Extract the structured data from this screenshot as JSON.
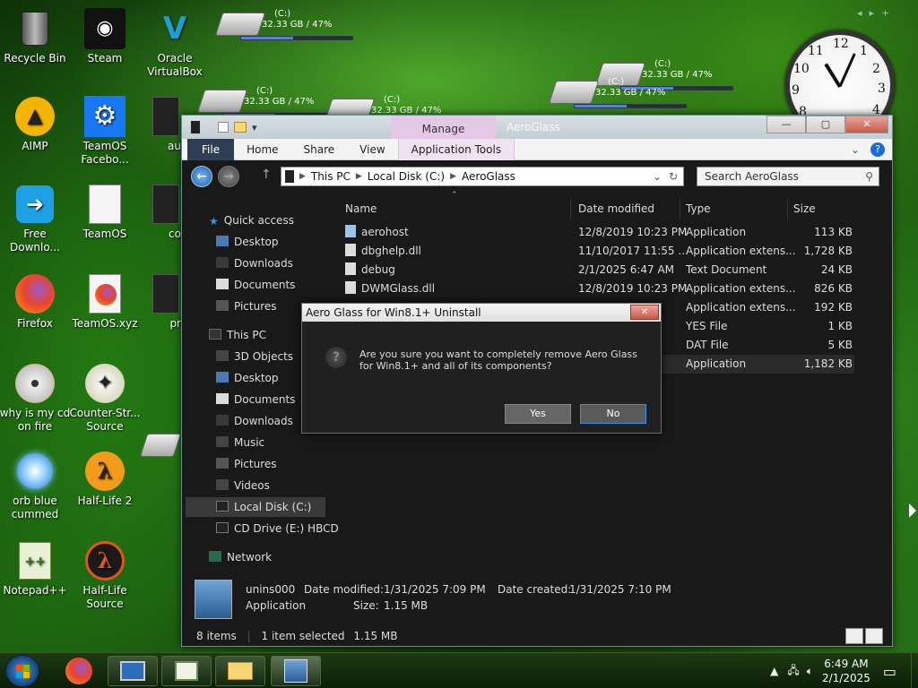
{
  "desktop": {
    "icons": [
      {
        "label": "Recycle Bin",
        "icon": "recycle-bin-icon"
      },
      {
        "label": "Steam",
        "icon": "steam-icon"
      },
      {
        "label": "Oracle VirtualBox",
        "icon": "virtualbox-icon"
      },
      {
        "label": "AIMP",
        "icon": "aimp-icon"
      },
      {
        "label": "TeamOS Facebo...",
        "icon": "settings-gear-icon"
      },
      {
        "label": "au",
        "icon": "shortcut-icon"
      },
      {
        "label": "Free Downlo...",
        "icon": "download-arrow-icon"
      },
      {
        "label": "TeamOS",
        "icon": "document-icon"
      },
      {
        "label": "co",
        "icon": "shortcut-icon"
      },
      {
        "label": "Firefox",
        "icon": "firefox-icon"
      },
      {
        "label": "TeamOS.xyz",
        "icon": "firefox-doc-icon"
      },
      {
        "label": "pr",
        "icon": "shortcut-icon"
      },
      {
        "label": "why is my cd on fire",
        "icon": "cd-fire-icon"
      },
      {
        "label": "Counter-Str... Source",
        "icon": "counter-strike-icon"
      },
      {
        "label": "orb blue cummed",
        "icon": "orb-icon"
      },
      {
        "label": "Half-Life 2",
        "icon": "half-life-2-icon"
      },
      {
        "label": "Notepad++",
        "icon": "notepad-plus-plus-icon"
      },
      {
        "label": "Half-Life Source",
        "icon": "half-life-source-icon"
      }
    ],
    "drive_widget": {
      "label": "(C:)",
      "usage": "32.33 GB / 47%",
      "used_fraction": 0.47
    }
  },
  "explorer": {
    "title": "AeroGlass",
    "context_tab": "Manage",
    "ribbon_tabs": [
      "File",
      "Home",
      "Share",
      "View",
      "Application Tools"
    ],
    "window_buttons": {
      "minimize": "—",
      "maximize": "▢",
      "close": "✕"
    },
    "address": [
      "This PC",
      "Local Disk (C:)",
      "AeroGlass"
    ],
    "search_placeholder": "Search AeroGlass",
    "nav": [
      {
        "label": "Quick access",
        "icon": "star-icon",
        "level": 0
      },
      {
        "label": "Desktop",
        "icon": "desktop-icon",
        "level": 1
      },
      {
        "label": "Downloads",
        "icon": "downloads-icon",
        "level": 1
      },
      {
        "label": "Documents",
        "icon": "documents-icon",
        "level": 1
      },
      {
        "label": "Pictures",
        "icon": "pictures-icon",
        "level": 1
      },
      {
        "label": "This PC",
        "icon": "computer-icon",
        "level": 0
      },
      {
        "label": "3D Objects",
        "icon": "objects-3d-icon",
        "level": 1
      },
      {
        "label": "Desktop",
        "icon": "desktop-icon",
        "level": 1
      },
      {
        "label": "Documents",
        "icon": "documents-icon",
        "level": 1
      },
      {
        "label": "Downloads",
        "icon": "downloads-icon",
        "level": 1
      },
      {
        "label": "Music",
        "icon": "music-icon",
        "level": 1
      },
      {
        "label": "Pictures",
        "icon": "pictures-icon",
        "level": 1
      },
      {
        "label": "Videos",
        "icon": "videos-icon",
        "level": 1
      },
      {
        "label": "Local Disk (C:)",
        "icon": "drive-icon",
        "level": 1,
        "selected": true
      },
      {
        "label": "CD Drive (E:) HBCD",
        "icon": "cd-drive-icon",
        "level": 1
      },
      {
        "label": "Network",
        "icon": "network-icon",
        "level": 0
      }
    ],
    "columns": [
      "Name",
      "Date modified",
      "Type",
      "Size"
    ],
    "files": [
      {
        "name": "aerohost",
        "date": "12/8/2019 10:23 PM",
        "type": "Application",
        "size": "113 KB"
      },
      {
        "name": "dbghelp.dll",
        "date": "11/10/2017 11:55 ...",
        "type": "Application extens...",
        "size": "1,728 KB"
      },
      {
        "name": "debug",
        "date": "2/1/2025 6:47 AM",
        "type": "Text Document",
        "size": "24 KB"
      },
      {
        "name": "DWMGlass.dll",
        "date": "12/8/2019 10:23 PM",
        "type": "Application extens...",
        "size": "826 KB"
      },
      {
        "name": "",
        "date": "",
        "type": "Application extens...",
        "size": "192 KB"
      },
      {
        "name": "",
        "date": "",
        "type": "YES File",
        "size": "1 KB"
      },
      {
        "name": "",
        "date": "",
        "type": "DAT File",
        "size": "5 KB"
      },
      {
        "name": "",
        "date": "",
        "type": "Application",
        "size": "1,182 KB",
        "selected": true
      }
    ],
    "details": {
      "name": "unins000",
      "kind": "Application",
      "date_modified_label": "Date modified:",
      "date_modified": "1/31/2025 7:09 PM",
      "date_created_label": "Date created:",
      "date_created": "1/31/2025 7:10 PM",
      "size_label": "Size:",
      "size": "1.15 MB"
    },
    "status": {
      "items": "8 items",
      "selected": "1 item selected",
      "size": "1.15 MB"
    }
  },
  "dialog": {
    "title": "Aero Glass for Win8.1+ Uninstall",
    "message": "Are you sure you want to completely remove Aero Glass for Win8.1+ and all of its components?",
    "yes": "Yes",
    "no": "No",
    "close": "✕"
  },
  "taskbar": {
    "items": [
      "firefox-icon",
      "remote-desktop-icon",
      "notepad-window-icon",
      "file-explorer-icon",
      "uninstaller-icon"
    ],
    "time": "6:49 AM",
    "date": "2/1/2025"
  },
  "colors": {
    "accent": "#3b8ee8",
    "manage": "#e3c9e6",
    "file_tab": "#2e3e55",
    "explorer_bg": "#191919"
  }
}
